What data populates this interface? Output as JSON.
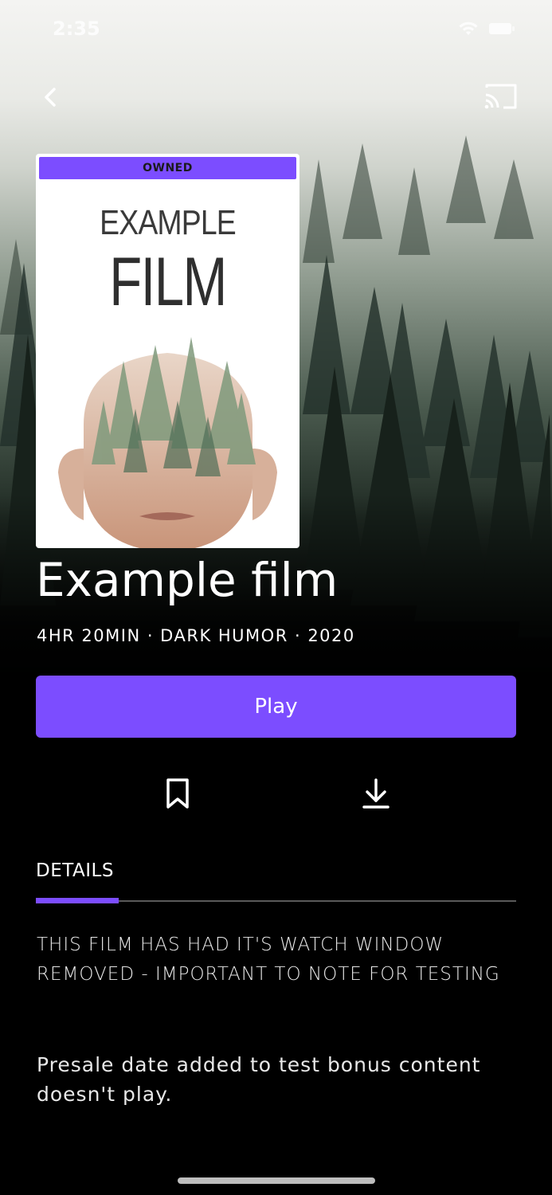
{
  "status_bar": {
    "time": "2:35",
    "wifi_icon": "wifi-icon",
    "battery_icon": "battery-icon"
  },
  "nav": {
    "back_icon": "chevron-left-icon",
    "cast_icon": "cast-icon"
  },
  "poster": {
    "badge": "OWNED",
    "title_line1": "EXAMPLE",
    "title_line2": "FILM"
  },
  "film": {
    "title": "Example film",
    "meta": "4HR 20MIN · DARK HUMOR · 2020"
  },
  "actions": {
    "play_label": "Play",
    "bookmark_icon": "bookmark-icon",
    "download_icon": "download-icon"
  },
  "tabs": {
    "details_label": "DETAILS"
  },
  "details": {
    "note": "THIS FILM HAS HAD IT'S WATCH WINDOW REMOVED - IMPORTANT TO NOTE FOR TESTING",
    "presale": "Presale date added to test bonus content doesn't play."
  },
  "colors": {
    "accent": "#7c4dff",
    "background": "#000000",
    "text": "#ffffff"
  }
}
